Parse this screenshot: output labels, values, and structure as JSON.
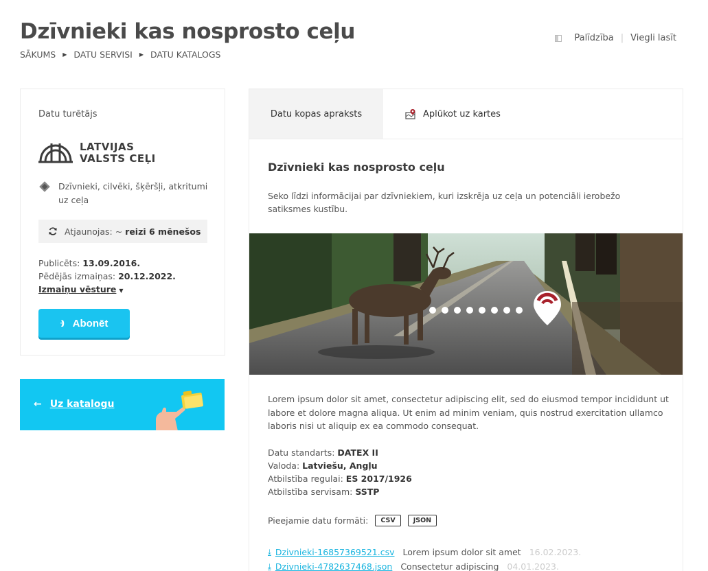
{
  "page": {
    "title": "Dzīvnieki kas nosprosto ceļu",
    "breadcrumb": [
      "SĀKUMS",
      "DATU SERVISI",
      "DATU KATALOGS"
    ],
    "top_links": {
      "help": "Palīdzība",
      "easy_read": "Viegli lasīt"
    }
  },
  "holder": {
    "label": "Datu turētājs",
    "logo_line1": "LATVIJAS",
    "logo_line2": "VALSTS CEĻI",
    "tags": "Dzīvnieki, cilvēki, šķēršļi, atkritumi uz ceļa",
    "update_prefix": "Atjaunojas: ~",
    "update_value": "reizi 6 mēnešos",
    "published_label": "Publicēts:",
    "published_value": "13.09.2016.",
    "modified_label": "Pēdējās izmaiņas:",
    "modified_value": "20.12.2022.",
    "history_link": "Izmaiņu vēsture",
    "subscribe": "Abonēt"
  },
  "catalog_banner": {
    "label": "Uz katalogu"
  },
  "tabs": [
    {
      "label": "Datu kopas apraksts",
      "active": true
    },
    {
      "label": "Aplūkot uz kartes",
      "active": false
    }
  ],
  "content": {
    "title": "Dzīvnieki kas nosprosto ceļu",
    "description": "Seko līdzi informācijai par dzīvniekiem, kuri izskrēja uz ceļa un potenciāli ierobežo satiksmes kustību.",
    "lorem": "Lorem ipsum dolor sit amet, consectetur adipiscing elit, sed do eiusmod tempor incididunt ut labore et dolore magna aliqua. Ut enim ad minim veniam, quis nostrud exercitation ullamco laboris nisi ut aliquip ex ea commodo consequat.",
    "meta": [
      {
        "label": "Datu standarts:",
        "value": "DATEX II"
      },
      {
        "label": "Valoda:",
        "value": "Latviešu, Angļu"
      },
      {
        "label": "Atbilstība regulai:",
        "value": "ES 2017/1926"
      },
      {
        "label": "Atbilstība servisam:",
        "value": "SSTP"
      }
    ],
    "formats_label": "Pieejamie datu formāti:",
    "formats": [
      "CSV",
      "JSON"
    ],
    "files": [
      {
        "name": "Dzivnieki-16857369521.csv",
        "desc": "Lorem ipsum dolor sit amet",
        "date": "16.02.2023."
      },
      {
        "name": "Dzivnieki-4782637468.json",
        "desc": "Consectetur adipiscing",
        "date": "04.01.2023."
      }
    ]
  },
  "colors": {
    "accent": "#1ac4f0",
    "banner": "#12c7f2",
    "link": "#18b4df",
    "pin": "#a8212b"
  }
}
